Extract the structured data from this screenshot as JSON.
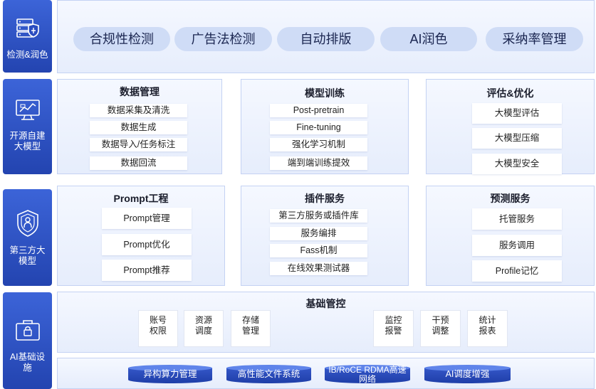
{
  "sides": [
    {
      "label": "检测&润色"
    },
    {
      "label": "开源自建\n大模型"
    },
    {
      "label": "第三方大\n模型"
    },
    {
      "label": "AI基础设\n施"
    }
  ],
  "top_pills": [
    "合规性检测",
    "广告法检测",
    "自动排版",
    "AI润色",
    "采纳率管理"
  ],
  "open_source": {
    "data_mgmt": {
      "title": "数据管理",
      "items": [
        "数据采集及清洗",
        "数据生成",
        "数据导入/任务标注",
        "数据回流"
      ]
    },
    "model_train": {
      "title": "模型训练",
      "items": [
        "Post-pretrain",
        "Fine-tuning",
        "强化学习机制",
        "端到端训练提效"
      ]
    },
    "eval_opt": {
      "title": "评估&优化",
      "items": [
        "大模型评估",
        "大模型压缩",
        "大模型安全"
      ]
    }
  },
  "third_party": {
    "prompt": {
      "title": "Prompt工程",
      "items": [
        "Prompt管理",
        "Prompt优化",
        "Prompt推荐"
      ]
    },
    "plugin": {
      "title": "插件服务",
      "items": [
        "第三方服务或插件库",
        "服务编排",
        "Fass机制",
        "在线效果测试器"
      ]
    },
    "predict": {
      "title": "预测服务",
      "items": [
        "托管服务",
        "服务调用",
        "Profile记忆"
      ]
    }
  },
  "infra": {
    "title": "基础管控",
    "boxes": [
      {
        "l1": "账号",
        "l2": "权限"
      },
      {
        "l1": "资源",
        "l2": "调度"
      },
      {
        "l1": "存储",
        "l2": "管理"
      },
      {
        "l1": "监控",
        "l2": "报警"
      },
      {
        "l1": "干预",
        "l2": "调整"
      },
      {
        "l1": "统计",
        "l2": "报表"
      }
    ],
    "cylinders": [
      "异构算力管理",
      "高性能文件系统",
      "IB/RoCE RDMA高速网络",
      "AI调度增强"
    ]
  }
}
